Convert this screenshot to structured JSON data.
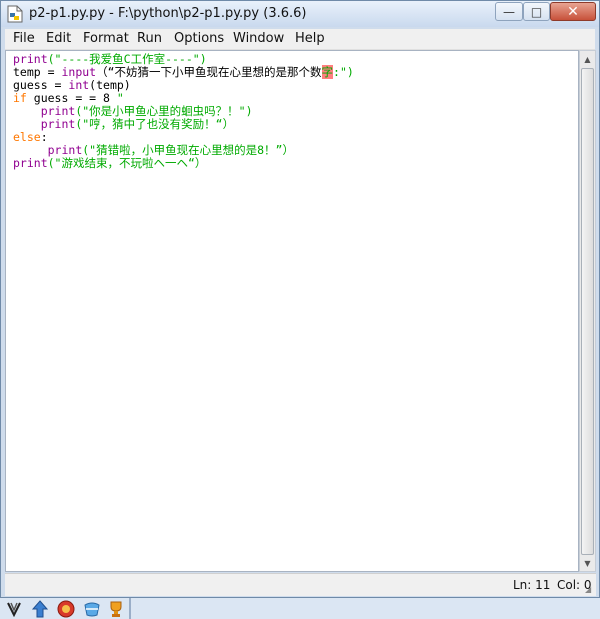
{
  "window": {
    "title": "p2-p1.py.py - F:\\python\\p2-p1.py.py (3.6.6)"
  },
  "controls": {
    "minimize": "—",
    "maximize": "□",
    "close": "✕"
  },
  "menu": [
    "File",
    "Edit",
    "Format",
    "Run",
    "Options",
    "Window",
    "Help"
  ],
  "code": {
    "l1_fn": "print",
    "l1_str": "(\"----我爱鱼C工作室----\")",
    "l2_a": "temp = ",
    "l2_fn": "input",
    "l2_str1": "（“不妨猜一下小甲鱼现在心里想的是那个数",
    "l2_hl": "字",
    "l2_str2": ":\")",
    "l3_a": "guess = ",
    "l3_fn": "int",
    "l3_b": "(temp)",
    "l4_kw": "if",
    "l4_b": " guess = = 8 ",
    "l4_str": "\"",
    "l5_indent": "    ",
    "l5_fn": "print",
    "l5_str": "(\"你是小甲鱼心里的蛔虫吗？！\")",
    "l6_indent": "    ",
    "l6_fn": "print",
    "l6_str": "(\"哼，猜中了也没有奖励！“）",
    "l7_kw": "else",
    "l7_b": ":",
    "l8_indent": "     ",
    "l8_fn": "print",
    "l8_str": "(\"猜错啦，小甲鱼现在心里想的是8！”）",
    "l9_fn": "print",
    "l9_str": "(\"游戏结束，不玩啦ヘ一ヘ“）"
  },
  "status": {
    "line": "Ln: 11",
    "col": "Col: 0"
  },
  "colors": {
    "keyword": "#ff7700",
    "builtin": "#900090",
    "string": "#00aa00",
    "highlight": "#ff7f7f"
  },
  "taskbar_icons": [
    "app-icon-1",
    "arrow-up-icon",
    "red-shield-icon",
    "blue-globe-icon",
    "trophy-icon"
  ]
}
